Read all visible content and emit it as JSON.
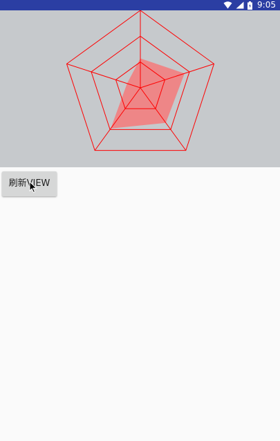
{
  "status_bar": {
    "time": "9:05",
    "background": "#2b3ea3",
    "icons": [
      "wifi-icon",
      "signal-icon",
      "battery-icon"
    ]
  },
  "radar": {
    "background": "#c6c9cc",
    "grid_color": "#ff0000",
    "fill_color": "#f47a7a",
    "levels": 3,
    "axes": 5,
    "values": [
      0.38,
      0.6,
      0.56,
      0.65,
      0.18
    ]
  },
  "refresh_button": {
    "label": "刷新VIEW"
  }
}
